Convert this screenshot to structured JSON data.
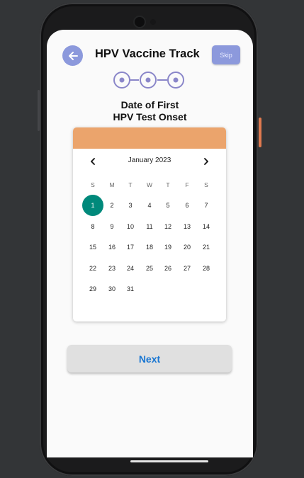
{
  "header": {
    "title": "HPV Vaccine Track",
    "skip_label": "Skip"
  },
  "stepper": {
    "steps": 3,
    "current": 1
  },
  "question": {
    "line1": "Date of First",
    "line2": "HPV Test Onset"
  },
  "calendar": {
    "month_label": "January 2023",
    "weekdays": [
      "S",
      "M",
      "T",
      "W",
      "T",
      "F",
      "S"
    ],
    "days": [
      "1",
      "2",
      "3",
      "4",
      "5",
      "6",
      "7",
      "8",
      "9",
      "10",
      "11",
      "12",
      "13",
      "14",
      "15",
      "16",
      "17",
      "18",
      "19",
      "20",
      "21",
      "22",
      "23",
      "24",
      "25",
      "26",
      "27",
      "28",
      "29",
      "30",
      "31"
    ],
    "selected_day": "1",
    "header_color": "#eba46c",
    "selected_color": "#00897b"
  },
  "next_button": {
    "label": "Next"
  },
  "colors": {
    "accent": "#8c99dc",
    "link_blue": "#1976d2"
  }
}
